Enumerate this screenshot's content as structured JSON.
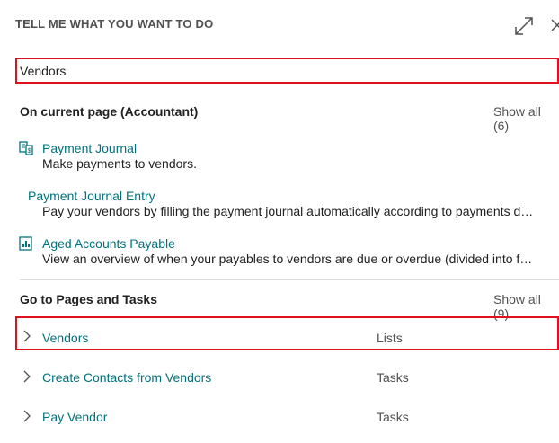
{
  "header": {
    "title": "TELL ME WHAT YOU WANT TO DO"
  },
  "search": {
    "value": "Vendors"
  },
  "current_page": {
    "title": "On current page (Accountant)",
    "show_all": "Show all (6)",
    "items": [
      {
        "title": "Payment Journal",
        "description": "Make payments to vendors.",
        "icon": "journal-icon"
      },
      {
        "title": "Payment Journal Entry",
        "description": "Pay your vendors by filling the payment journal automatically according to payments d…",
        "icon": ""
      },
      {
        "title": "Aged Accounts Payable",
        "description": "View an overview of when your payables to vendors are due or overdue (divided into fo…",
        "icon": "report-icon"
      }
    ]
  },
  "pages_tasks": {
    "title": "Go to Pages and Tasks",
    "show_all": "Show all (9)",
    "items": [
      {
        "name": "Vendors",
        "category": "Lists"
      },
      {
        "name": "Create Contacts from Vendors",
        "category": "Tasks"
      },
      {
        "name": "Pay Vendor",
        "category": "Tasks"
      }
    ]
  },
  "colors": {
    "accent": "#00727c",
    "highlight": "#e0101d"
  }
}
